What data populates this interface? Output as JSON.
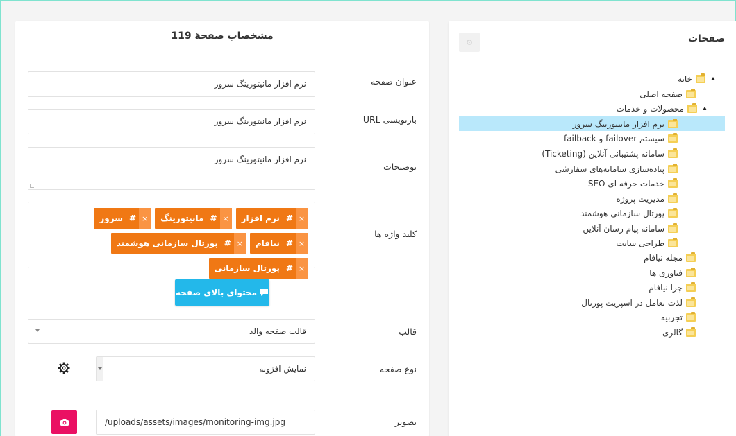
{
  "props_panel": {
    "title": "مشخصاتِ صفحهٔ 119",
    "fields": {
      "title_label": "عنوان صفحه",
      "title_value": "نرم افزار مانیتورینگ سرور",
      "url_label": "بازنویسی URL",
      "url_value": "نرم افزار مانیتورینگ سرور",
      "desc_label": "توضیحات",
      "desc_value": "نرم افزار مانیتورینگ سرور",
      "keywords_label": "کلید واژه ها",
      "template_label": "قالب",
      "template_value": "قالب صفحه والد",
      "pagetype_label": "نوع صفحه",
      "pagetype_value": "نمایش افزونه",
      "image_label": "تصویر",
      "image_value": "/uploads/assets/images/monitoring-img.jpg"
    },
    "keywords": [
      {
        "text": "نرم افزار",
        "hash": "#",
        "remove": "×"
      },
      {
        "text": "مانیتورینگ",
        "hash": "#",
        "remove": "×"
      },
      {
        "text": "سرور",
        "hash": "#",
        "remove": "×"
      },
      {
        "text": "نیافام",
        "hash": "#",
        "remove": "×"
      },
      {
        "text": "پورتال سازمانی هوشمند",
        "hash": "#",
        "remove": "×"
      },
      {
        "text": "پورتال سازمانی",
        "hash": "#",
        "remove": "×"
      }
    ],
    "content_button": "محتوای بالای صفحه",
    "icons": {
      "gear": "gear-icon",
      "camera": "camera-icon",
      "comment": "comment-icon"
    },
    "colors": {
      "tag": "#f07814",
      "tag_remove": "#fa9443",
      "content_button": "#23b8ea",
      "camera_button": "#ea1063"
    }
  },
  "pages_panel": {
    "title": "صفحات",
    "tree": [
      {
        "label": "خانه",
        "level": 0,
        "expanded": true
      },
      {
        "label": "صفحه اصلی",
        "level": 1
      },
      {
        "label": "محصولات و خدمات",
        "level": 1,
        "expanded": true
      },
      {
        "label": "نرم افزار مانیتورینگ سرور",
        "level": 2,
        "selected": true
      },
      {
        "label": "سیستم failover و failback",
        "level": 2
      },
      {
        "label": "سامانه پشتیبانی آنلاین (Ticketing)",
        "level": 2
      },
      {
        "label": "پیاده‌سازی سامانه‌های سفارشی",
        "level": 2
      },
      {
        "label": "خدمات حرفه ای SEO",
        "level": 2
      },
      {
        "label": "مدیریت پروژه",
        "level": 2
      },
      {
        "label": "پورتال سازمانی هوشمند",
        "level": 2
      },
      {
        "label": "سامانه پیام رسان آنلاین",
        "level": 2
      },
      {
        "label": "طراحی سایت",
        "level": 2
      },
      {
        "label": "مجله نیافام",
        "level": 1
      },
      {
        "label": "فناوری ها",
        "level": 1
      },
      {
        "label": "چرا نیافام",
        "level": 1
      },
      {
        "label": "لذت تعامل در اسپریت پورتال",
        "level": 1
      },
      {
        "label": "تجربیه",
        "level": 1
      },
      {
        "label": "گالری",
        "level": 1
      }
    ],
    "selected_color": "#b9e8fb"
  }
}
